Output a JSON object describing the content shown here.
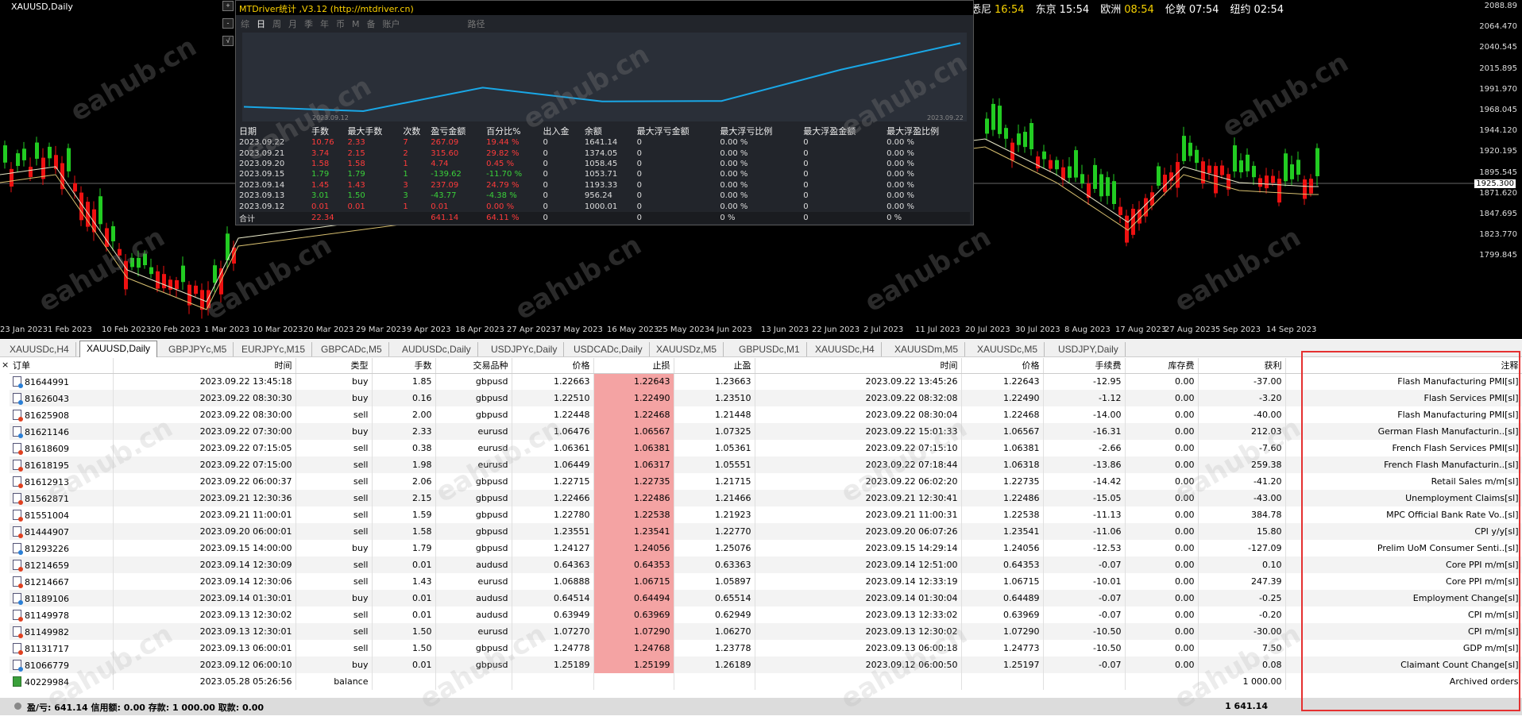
{
  "chart": {
    "title": "XAUUSD,Daily",
    "price_labels": [
      "2088.89",
      "2064.470",
      "2040.545",
      "2015.895",
      "1991.970",
      "1968.045",
      "1944.120",
      "1920.195",
      "1895.545",
      "1871.620",
      "1847.695",
      "1823.770",
      "1799.845"
    ],
    "current_price": "1925.300",
    "date_labels": [
      "23 Jan 2023",
      "1 Feb 2023",
      "10 Feb 2023",
      "20 Feb 2023",
      "1 Mar 2023",
      "10 Mar 2023",
      "20 Mar 2023",
      "29 Mar 2023",
      "9 Apr 2023",
      "18 Apr 2023",
      "27 Apr 2023",
      "7 May 2023",
      "16 May 2023",
      "25 May 2023",
      "4 Jun 2023",
      "13 Jun 2023",
      "22 Jun 2023",
      "2 Jul 2023",
      "11 Jul 2023",
      "20 Jul 2023",
      "30 Jul 2023",
      "8 Aug 2023",
      "17 Aug 2023",
      "27 Aug 2023",
      "5 Sep 2023",
      "14 Sep 2023"
    ],
    "toolbar_buttons": [
      "+",
      "-",
      "√"
    ],
    "clocks": [
      {
        "city": "悉尼",
        "time": "16:54"
      },
      {
        "city": "东京",
        "time": "15:54"
      },
      {
        "city": "欧洲",
        "time": "08:54"
      },
      {
        "city": "伦敦",
        "time": "07:54"
      },
      {
        "city": "纽约",
        "time": "02:54"
      }
    ],
    "up_color": "#22cc22",
    "down_color": "#ee1111"
  },
  "mtdriver": {
    "title": "MTDriver统计 ,V3.12 (http://mtdriver.cn)",
    "tabs": [
      "综",
      "日",
      "周",
      "月",
      "季",
      "年",
      "币",
      "M",
      "备",
      "账户"
    ],
    "active_tab": "日",
    "path_label": "路径",
    "mini_start": "2023.09.12",
    "mini_end": "2023.09.22",
    "balance_series": [
      1000.01,
      956.24,
      1193.33,
      1053.71,
      1058.45,
      1374.05,
      1641.14
    ],
    "headers": [
      "日期",
      "手数",
      "最大手数",
      "次数",
      "盈亏金额",
      "百分比%",
      "出入金",
      "余额",
      "最大浮亏金额",
      "最大浮亏比例",
      "最大浮盈金额",
      "最大浮盈比例"
    ],
    "rows": [
      [
        "2023.09.22",
        "10.76",
        "2.33",
        "7",
        "267.09",
        "19.44 %",
        "0",
        "1641.14",
        "0",
        "0.00 %",
        "0",
        "0.00 %"
      ],
      [
        "2023.09.21",
        "3.74",
        "2.15",
        "2",
        "315.60",
        "29.82 %",
        "0",
        "1374.05",
        "0",
        "0.00 %",
        "0",
        "0.00 %"
      ],
      [
        "2023.09.20",
        "1.58",
        "1.58",
        "1",
        "4.74",
        "0.45 %",
        "0",
        "1058.45",
        "0",
        "0.00 %",
        "0",
        "0.00 %"
      ],
      [
        "2023.09.15",
        "1.79",
        "1.79",
        "1",
        "-139.62",
        "-11.70 %",
        "0",
        "1053.71",
        "0",
        "0.00 %",
        "0",
        "0.00 %"
      ],
      [
        "2023.09.14",
        "1.45",
        "1.43",
        "3",
        "237.09",
        "24.79 %",
        "0",
        "1193.33",
        "0",
        "0.00 %",
        "0",
        "0.00 %"
      ],
      [
        "2023.09.13",
        "3.01",
        "1.50",
        "3",
        "-43.77",
        "-4.38 %",
        "0",
        "956.24",
        "0",
        "0.00 %",
        "0",
        "0.00 %"
      ],
      [
        "2023.09.12",
        "0.01",
        "0.01",
        "1",
        "0.01",
        "0.00 %",
        "0",
        "1000.01",
        "0",
        "0.00 %",
        "0",
        "0.00 %"
      ]
    ],
    "row_colors": [
      "r",
      "r",
      "r",
      "g",
      "r",
      "g",
      "r"
    ],
    "total": [
      "合计",
      "22.34",
      "",
      "",
      "641.14",
      "64.11 %",
      "0",
      "",
      "0",
      "0 %",
      "0",
      "0 %"
    ]
  },
  "chart_tabs": [
    "XAUUSDc,H4",
    "XAUUSD,Daily",
    "GBPJPYc,M5",
    "EURJPYc,M15",
    "GBPCADc,M5",
    "AUDUSDc,Daily",
    "USDJPYc,Daily",
    "USDCADc,Daily",
    "XAUUSDz,M5",
    "GBPUSDc,M1",
    "XAUUSDc,H4",
    "XAUUSDm,M5",
    "XAUUSDc,M5",
    "USDJPY,Daily"
  ],
  "active_chart_tab": "XAUUSD,Daily",
  "orders": {
    "close_label": "×",
    "headers": [
      "订单",
      "时间",
      "类型",
      "手数",
      "交易品种",
      "价格",
      "止损",
      "止盈",
      "时间",
      "价格",
      "手续费",
      "库存费",
      "获利",
      "注释"
    ],
    "rows": [
      [
        "81644991",
        "2023.09.22 13:45:18",
        "buy",
        "1.85",
        "gbpusd",
        "1.22663",
        "1.22643",
        "1.23663",
        "2023.09.22 13:45:26",
        "1.22643",
        "-12.95",
        "0.00",
        "-37.00",
        "Flash Manufacturing PMI[sl]"
      ],
      [
        "81626043",
        "2023.09.22 08:30:30",
        "buy",
        "0.16",
        "gbpusd",
        "1.22510",
        "1.22490",
        "1.23510",
        "2023.09.22 08:32:08",
        "1.22490",
        "-1.12",
        "0.00",
        "-3.20",
        "Flash Services PMI[sl]"
      ],
      [
        "81625908",
        "2023.09.22 08:30:00",
        "sell",
        "2.00",
        "gbpusd",
        "1.22448",
        "1.22468",
        "1.21448",
        "2023.09.22 08:30:04",
        "1.22468",
        "-14.00",
        "0.00",
        "-40.00",
        "Flash Manufacturing PMI[sl]"
      ],
      [
        "81621146",
        "2023.09.22 07:30:00",
        "buy",
        "2.33",
        "eurusd",
        "1.06476",
        "1.06567",
        "1.07325",
        "2023.09.22 15:01:33",
        "1.06567",
        "-16.31",
        "0.00",
        "212.03",
        "German Flash Manufacturin..[sl]"
      ],
      [
        "81618609",
        "2023.09.22 07:15:05",
        "sell",
        "0.38",
        "eurusd",
        "1.06361",
        "1.06381",
        "1.05361",
        "2023.09.22 07:15:10",
        "1.06381",
        "-2.66",
        "0.00",
        "-7.60",
        "French Flash Services PMI[sl]"
      ],
      [
        "81618195",
        "2023.09.22 07:15:00",
        "sell",
        "1.98",
        "eurusd",
        "1.06449",
        "1.06317",
        "1.05551",
        "2023.09.22 07:18:44",
        "1.06318",
        "-13.86",
        "0.00",
        "259.38",
        "French Flash Manufacturin..[sl]"
      ],
      [
        "81612913",
        "2023.09.22 06:00:37",
        "sell",
        "2.06",
        "gbpusd",
        "1.22715",
        "1.22735",
        "1.21715",
        "2023.09.22 06:02:20",
        "1.22735",
        "-14.42",
        "0.00",
        "-41.20",
        "Retail Sales m/m[sl]"
      ],
      [
        "81562871",
        "2023.09.21 12:30:36",
        "sell",
        "2.15",
        "gbpusd",
        "1.22466",
        "1.22486",
        "1.21466",
        "2023.09.21 12:30:41",
        "1.22486",
        "-15.05",
        "0.00",
        "-43.00",
        "Unemployment Claims[sl]"
      ],
      [
        "81551004",
        "2023.09.21 11:00:01",
        "sell",
        "1.59",
        "gbpusd",
        "1.22780",
        "1.22538",
        "1.21923",
        "2023.09.21 11:00:31",
        "1.22538",
        "-11.13",
        "0.00",
        "384.78",
        "MPC Official Bank Rate Vo..[sl]"
      ],
      [
        "81444907",
        "2023.09.20 06:00:01",
        "sell",
        "1.58",
        "gbpusd",
        "1.23551",
        "1.23541",
        "1.22770",
        "2023.09.20 06:07:26",
        "1.23541",
        "-11.06",
        "0.00",
        "15.80",
        "CPI y/y[sl]"
      ],
      [
        "81293226",
        "2023.09.15 14:00:00",
        "buy",
        "1.79",
        "gbpusd",
        "1.24127",
        "1.24056",
        "1.25076",
        "2023.09.15 14:29:14",
        "1.24056",
        "-12.53",
        "0.00",
        "-127.09",
        "Prelim UoM Consumer Senti..[sl]"
      ],
      [
        "81214659",
        "2023.09.14 12:30:09",
        "sell",
        "0.01",
        "audusd",
        "0.64363",
        "0.64353",
        "0.63363",
        "2023.09.14 12:51:00",
        "0.64353",
        "-0.07",
        "0.00",
        "0.10",
        "Core PPI m/m[sl]"
      ],
      [
        "81214667",
        "2023.09.14 12:30:06",
        "sell",
        "1.43",
        "eurusd",
        "1.06888",
        "1.06715",
        "1.05897",
        "2023.09.14 12:33:19",
        "1.06715",
        "-10.01",
        "0.00",
        "247.39",
        "Core PPI m/m[sl]"
      ],
      [
        "81189106",
        "2023.09.14 01:30:01",
        "buy",
        "0.01",
        "audusd",
        "0.64514",
        "0.64494",
        "0.65514",
        "2023.09.14 01:30:04",
        "0.64489",
        "-0.07",
        "0.00",
        "-0.25",
        "Employment Change[sl]"
      ],
      [
        "81149978",
        "2023.09.13 12:30:02",
        "sell",
        "0.01",
        "audusd",
        "0.63949",
        "0.63969",
        "0.62949",
        "2023.09.13 12:33:02",
        "0.63969",
        "-0.07",
        "0.00",
        "-0.20",
        "CPI m/m[sl]"
      ],
      [
        "81149982",
        "2023.09.13 12:30:01",
        "sell",
        "1.50",
        "eurusd",
        "1.07270",
        "1.07290",
        "1.06270",
        "2023.09.13 12:30:02",
        "1.07290",
        "-10.50",
        "0.00",
        "-30.00",
        "CPI m/m[sl]"
      ],
      [
        "81131717",
        "2023.09.13 06:00:01",
        "sell",
        "1.50",
        "gbpusd",
        "1.24778",
        "1.24768",
        "1.23778",
        "2023.09.13 06:00:18",
        "1.24773",
        "-10.50",
        "0.00",
        "7.50",
        "GDP m/m[sl]"
      ],
      [
        "81066779",
        "2023.09.12 06:00:10",
        "buy",
        "0.01",
        "gbpusd",
        "1.25189",
        "1.25199",
        "1.26189",
        "2023.09.12 06:00:50",
        "1.25197",
        "-0.07",
        "0.00",
        "0.08",
        "Claimant Count Change[sl]"
      ]
    ],
    "balance_row": {
      "order": "40229984",
      "time": "2023.05.28 05:26:56",
      "type": "balance",
      "profit": "1 000.00",
      "comment": "Archived orders"
    },
    "summary_text": "盈/亏: 641.14  信用额: 0.00  存款: 1 000.00  取款: 0.00",
    "summary_total": "1 641.14"
  },
  "watermark": "eahub.cn"
}
